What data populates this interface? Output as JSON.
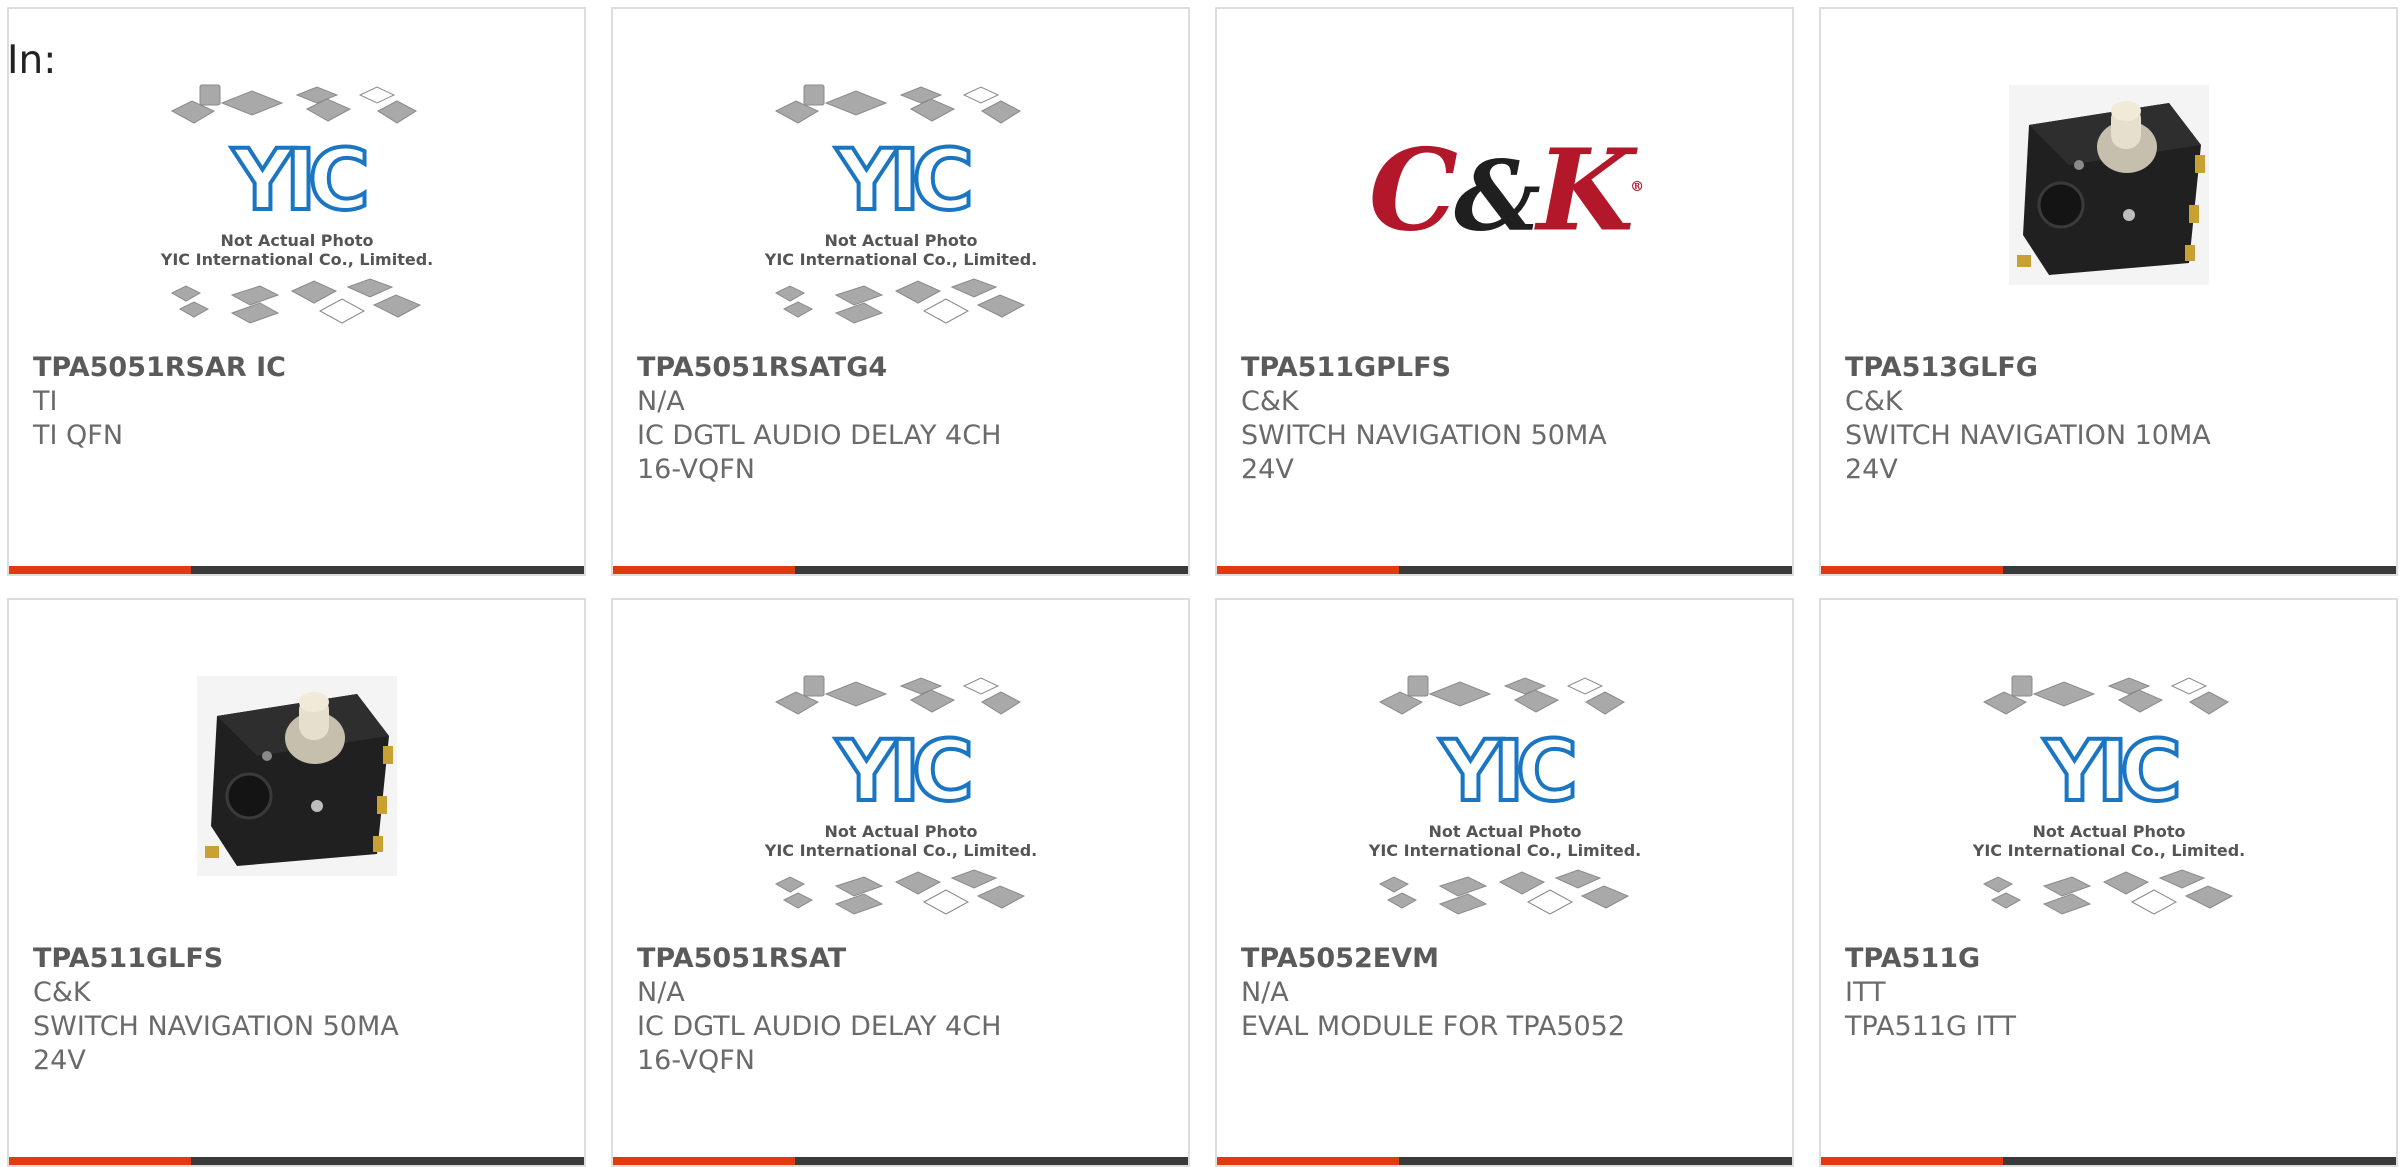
{
  "page": {
    "label": "In:"
  },
  "theme": {
    "accent": "#e03a0e",
    "bar": "#3a3a3a",
    "border": "#dddddd",
    "yic_blue": "#1a76c2",
    "cnk_red": "#b3182a"
  },
  "placeholder": {
    "caption_line1": "Not Actual Photo",
    "caption_line2": "YIC International Co., Limited.",
    "logo_text": "YIC"
  },
  "cnk_logo": {
    "left": "C",
    "amp": "&",
    "right": "K",
    "reg": "®"
  },
  "products": [
    {
      "part_number": "TPA5051RSAR IC",
      "manufacturer": "TI",
      "description": "TI QFN",
      "image": "yic-placeholder"
    },
    {
      "part_number": "TPA5051RSATG4",
      "manufacturer": "N/A",
      "description": "IC DGTL AUDIO DELAY 4CH 16-VQFN",
      "image": "yic-placeholder"
    },
    {
      "part_number": "TPA511GPLFS",
      "manufacturer": "C&K",
      "description": "SWITCH NAVIGATION 50MA 24V",
      "image": "ck-logo"
    },
    {
      "part_number": "TPA513GLFG",
      "manufacturer": "C&K",
      "description": "SWITCH NAVIGATION 10MA 24V",
      "image": "switch-photo"
    },
    {
      "part_number": "TPA511GLFS",
      "manufacturer": "C&K",
      "description": "SWITCH NAVIGATION 50MA 24V",
      "image": "switch-photo"
    },
    {
      "part_number": "TPA5051RSAT",
      "manufacturer": "N/A",
      "description": "IC DGTL AUDIO DELAY 4CH 16-VQFN",
      "image": "yic-placeholder"
    },
    {
      "part_number": "TPA5052EVM",
      "manufacturer": "N/A",
      "description": "EVAL MODULE FOR TPA5052",
      "image": "yic-placeholder"
    },
    {
      "part_number": "TPA511G",
      "manufacturer": "ITT",
      "description": "TPA511G ITT",
      "image": "yic-placeholder"
    }
  ]
}
